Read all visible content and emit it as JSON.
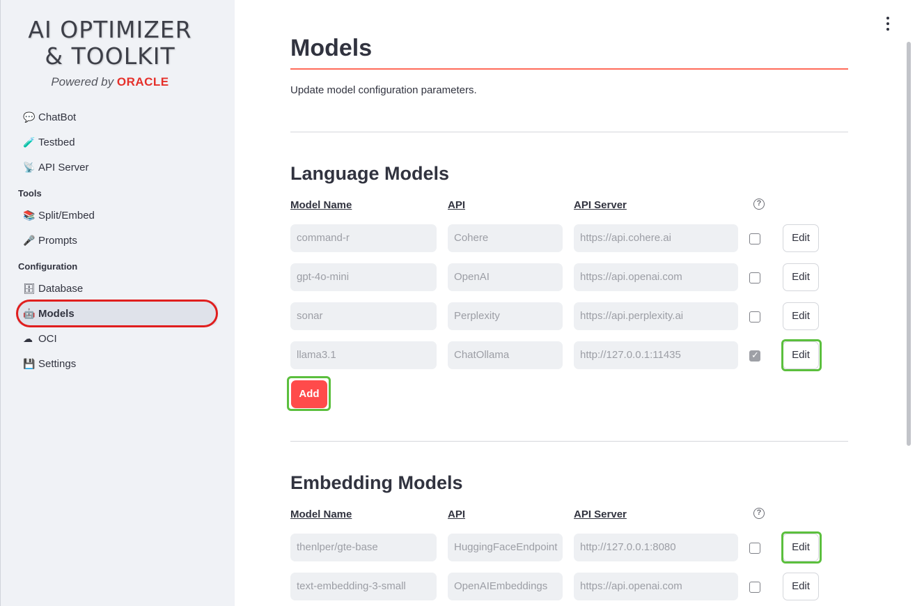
{
  "sidebar": {
    "logo": {
      "line1": "AI OPTIMIZER",
      "line2": "& TOOLKIT",
      "powered": "Powered by",
      "brand": "ORACLE"
    },
    "items_top": [
      {
        "label": "ChatBot",
        "icon": "💬"
      },
      {
        "label": "Testbed",
        "icon": "🧪"
      },
      {
        "label": "API Server",
        "icon": "📡"
      }
    ],
    "section_tools": "Tools",
    "items_tools": [
      {
        "label": "Split/Embed",
        "icon": "📚"
      },
      {
        "label": "Prompts",
        "icon": "🎤"
      }
    ],
    "section_config": "Configuration",
    "items_config": [
      {
        "label": "Database",
        "icon": "🗄"
      },
      {
        "label": "Models",
        "icon": "🤖"
      },
      {
        "label": "OCI",
        "icon": "☁"
      },
      {
        "label": "Settings",
        "icon": "💾"
      }
    ],
    "active": "Models"
  },
  "main": {
    "title": "Models",
    "subtitle": "Update model configuration parameters.",
    "columns": {
      "name": "Model Name",
      "api": "API",
      "server": "API Server",
      "help": "?"
    },
    "edit_label": "Edit",
    "add_label": "Add",
    "language": {
      "title": "Language Models",
      "rows": [
        {
          "name": "command-r",
          "api": "Cohere",
          "server": "https://api.cohere.ai",
          "enabled": false
        },
        {
          "name": "gpt-4o-mini",
          "api": "OpenAI",
          "server": "https://api.openai.com",
          "enabled": false
        },
        {
          "name": "sonar",
          "api": "Perplexity",
          "server": "https://api.perplexity.ai",
          "enabled": false
        },
        {
          "name": "llama3.1",
          "api": "ChatOllama",
          "server": "http://127.0.0.1:11435",
          "enabled": true
        }
      ]
    },
    "embedding": {
      "title": "Embedding Models",
      "rows": [
        {
          "name": "thenlper/gte-base",
          "api": "HuggingFaceEndpoint",
          "server": "http://127.0.0.1:8080",
          "enabled": false
        },
        {
          "name": "text-embedding-3-small",
          "api": "OpenAIEmbeddings",
          "server": "https://api.openai.com",
          "enabled": false
        }
      ]
    }
  },
  "colors": {
    "accent": "#ff4b4b",
    "highlight_green": "#5bbf3d",
    "highlight_red": "#e01e1e"
  }
}
